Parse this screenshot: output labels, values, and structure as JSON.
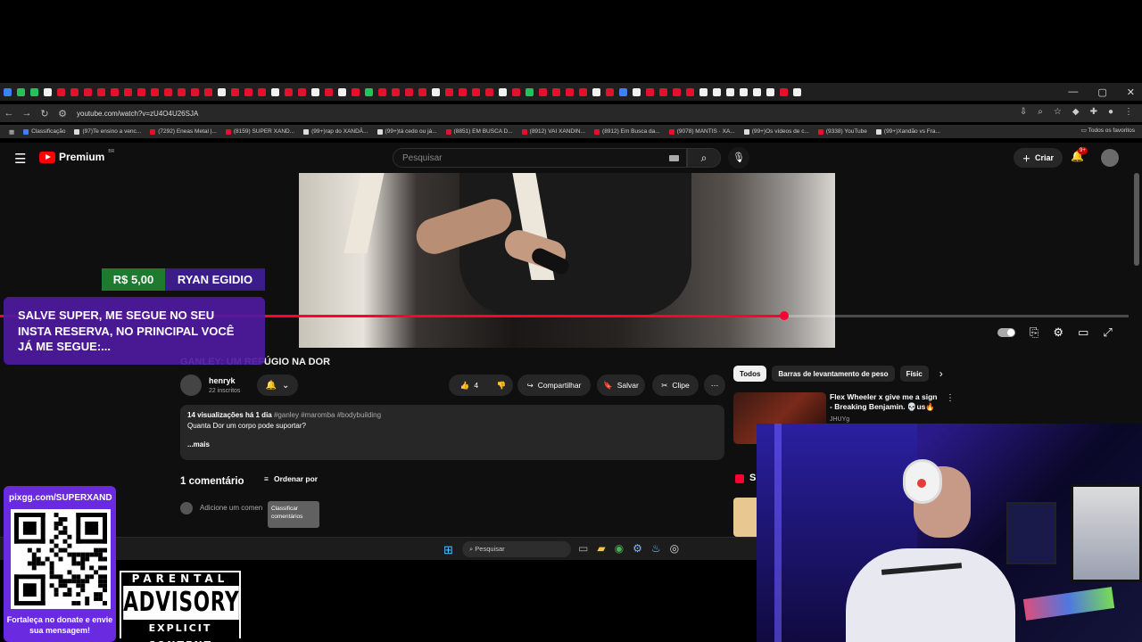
{
  "browser": {
    "url": "youtube.com/watch?v=zU4O4U26SJA",
    "bookmarks": [
      {
        "label": "Classificação",
        "kind": "bl"
      },
      {
        "label": "(97)Te ensino a venc...",
        "kind": "tk"
      },
      {
        "label": "(7292) Eneas Metal |...",
        "kind": "yt"
      },
      {
        "label": "(8159) SUPER XAND...",
        "kind": "yt"
      },
      {
        "label": "(99+)rap do XANDÃ...",
        "kind": "tk"
      },
      {
        "label": "(99+)tá cedo ou já...",
        "kind": "tk"
      },
      {
        "label": "(8851) EM BUSCA D...",
        "kind": "yt"
      },
      {
        "label": "(8912) VAI XANDIN...",
        "kind": "yt"
      },
      {
        "label": "(8912) Em Busca da...",
        "kind": "yt"
      },
      {
        "label": "(9078) MANTIS · XA...",
        "kind": "yt"
      },
      {
        "label": "(99+)Os vídeos de c...",
        "kind": "tk"
      },
      {
        "label": "(9338) YouTube",
        "kind": "yt"
      },
      {
        "label": "(99+)Xandão vs Fra...",
        "kind": "tk"
      }
    ],
    "all_bookmarks_label": "Todos os favoritos"
  },
  "youtube": {
    "logo_text": "Premium",
    "logo_region": "BR",
    "search_placeholder": "Pesquisar",
    "create_label": "Criar",
    "notifications_badge": "9+",
    "video_progress_fraction": 0.695,
    "video_title": "GANLEY: UM REFÚGIO NA DOR",
    "channel_name": "henryk",
    "channel_subs": "22 inscritos",
    "likes": "4",
    "share_label": "Compartilhar",
    "save_label": "Salvar",
    "clip_label": "Clipe",
    "views": "14 visualizações",
    "posted": "há 1 dia",
    "hashtags": "#ganley #maromba #bodybuilding",
    "description": "Quanta Dor um corpo pode suportar?",
    "more_label": "...mais",
    "comment_count": "1 comentário",
    "sort_label": "Ordenar por",
    "add_comment_placeholder": "Adicione um comen",
    "sort_tooltip": "Classificar comentários",
    "chips": [
      "Todos",
      "Barras de levantamento de peso",
      "Físic"
    ],
    "recommendation": {
      "title": "Flex Wheeler x give me a sign - Breaking Benjamin. 💀us🔥",
      "channel": "JHUYg"
    },
    "rec2_partial": "S"
  },
  "taskbar": {
    "search_label": "Pesquisar"
  },
  "overlay": {
    "donation_amount": "R$ 5,00",
    "donor_name": "RYAN EGIDIO",
    "donation_message": "SALVE SUPER, ME SEGUE NO SEU INSTA RESERVA, NO PRINCIPAL VOCÊ JÁ ME SEGUE:...",
    "pix_url": "pixgg.com/SUPERXAND",
    "pix_text": "Fortaleça no donate e envie sua mensagem!",
    "advisory_top": "PARENTAL",
    "advisory_mid": "ADVISORY",
    "advisory_bottom": "EXPLICIT CONTENT"
  },
  "colors": {
    "yt_red": "#ff0033",
    "donation_green": "#1e7a2e",
    "donation_purple": "#3a1c8a",
    "message_purple": "#4e1aa0",
    "pix_purple": "#6a2adf"
  }
}
